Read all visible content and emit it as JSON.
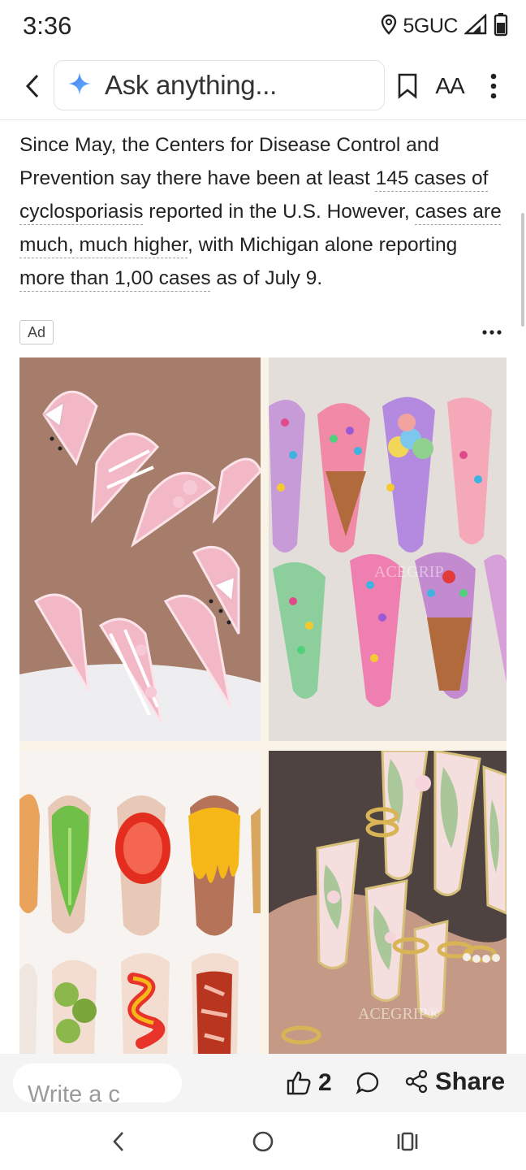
{
  "status_bar": {
    "time": "3:36",
    "network": "5GUC",
    "icons": [
      "location-icon",
      "signal-icon",
      "battery-icon"
    ]
  },
  "toolbar": {
    "back_icon": "chevron-left-icon",
    "ask_placeholder": "Ask anything...",
    "ask_icon": "sparkle-icon",
    "bookmark_icon": "bookmark-icon",
    "text_size_label": "AA",
    "more_icon": "more-vertical-icon",
    "accent_color": "#4285f4"
  },
  "article": {
    "text_1": "Since May, the Centers for Disease Control and Prevention say there have been at least ",
    "kw_1": "145 cases of cyclosporiasis",
    "text_2": " reported in the U.S. However, ",
    "kw_2": "cases are much, much higher",
    "text_3": ", with Michigan alone reporting ",
    "kw_3": "more than 1,00 cases",
    "text_4": " as of July 9."
  },
  "ad": {
    "label": "Ad",
    "more_icon": "more-horizontal-icon",
    "watermark_1": "ACEGRIP",
    "watermark_2": "ACEGRIP®"
  },
  "comment_bar": {
    "comment_placeholder": "Write a c",
    "like_icon": "thumbs-up-icon",
    "like_count": "2",
    "comment_icon": "comment-bubble-icon",
    "share_icon": "share-icon",
    "share_label": "Share"
  },
  "nav_bar": {
    "back_icon": "nav-back-icon",
    "home_icon": "nav-home-icon",
    "recents_icon": "nav-recents-icon"
  }
}
